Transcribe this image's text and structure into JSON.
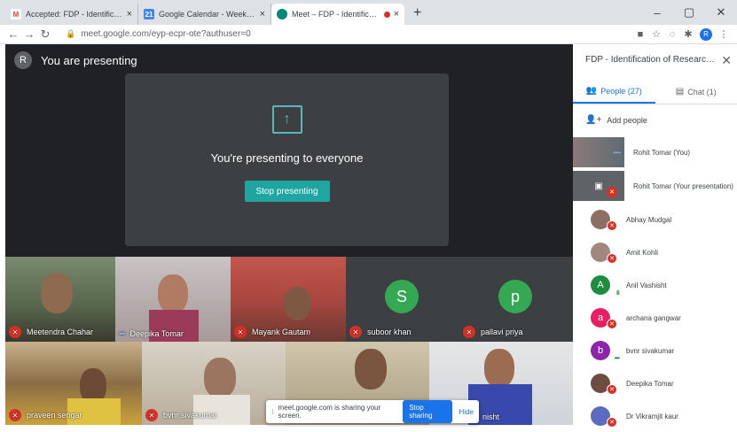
{
  "browser": {
    "tabs": [
      {
        "title": "Accepted: FDP - Identification of",
        "favicon": "M",
        "favicon_color": "#ea4335",
        "active": false
      },
      {
        "title": "Google Calendar - Week of 19 J",
        "favicon": "21",
        "favicon_color": "#4285f4",
        "active": false
      },
      {
        "title": "Meet – FDP - Identification",
        "favicon": "",
        "favicon_color": "#00897b",
        "active": true
      }
    ],
    "url": "meet.google.com/eyp-ecpr-ote?authuser=0",
    "profile_initial": "R"
  },
  "presenting": {
    "header_initial": "R",
    "header_text": "You are presenting",
    "message": "You're presenting to everyone",
    "stop_label": "Stop presenting"
  },
  "tiles": [
    {
      "name": "Meetendra Chahar",
      "muted": true
    },
    {
      "name": "Deepika Tomar",
      "muted": false,
      "speaking": true
    },
    {
      "name": "Mayank Gautam",
      "muted": true
    },
    {
      "name": "suboor khan",
      "muted": true,
      "initial": "S",
      "color": "#1e8e3e"
    },
    {
      "name": "pallavi priya",
      "muted": true,
      "initial": "p",
      "color": "#1e8e3e"
    },
    {
      "name": "praveen sengar",
      "muted": true
    },
    {
      "name": "bvnr sivakumar",
      "muted": true
    },
    {
      "name": "",
      "muted": false
    },
    {
      "name": "nisht",
      "muted": false
    }
  ],
  "share_bar": {
    "text": "meet.google.com is sharing your screen.",
    "stop_label": "Stop sharing",
    "hide_label": "Hide"
  },
  "panel": {
    "title": "FDP - Identification of Research ...",
    "people_tab": "People (27)",
    "chat_tab": "Chat (1)",
    "add_people": "Add people",
    "people": [
      {
        "name": "Rohit Tomar (You)",
        "type": "self"
      },
      {
        "name": "Rohit Tomar (Your presentation)",
        "type": "presentation"
      },
      {
        "name": "Abhay Mudgal",
        "type": "photo",
        "color": "#8d6e63"
      },
      {
        "name": "Amit Kohli",
        "type": "photo",
        "color": "#a1887f"
      },
      {
        "name": "Anil Vashisht",
        "type": "initial",
        "initial": "A",
        "color": "#1e8e3e",
        "speaking": true
      },
      {
        "name": "archana gangwar",
        "type": "initial",
        "initial": "a",
        "color": "#e91e63"
      },
      {
        "name": "bvnr sivakumar",
        "type": "initial",
        "initial": "b",
        "color": "#8e24aa",
        "speaking": true
      },
      {
        "name": "Deepika Tomar",
        "type": "photo",
        "color": "#6d4c41"
      },
      {
        "name": "Dr Vikramjit kaur",
        "type": "photo",
        "color": "#5c6bc0"
      }
    ]
  }
}
